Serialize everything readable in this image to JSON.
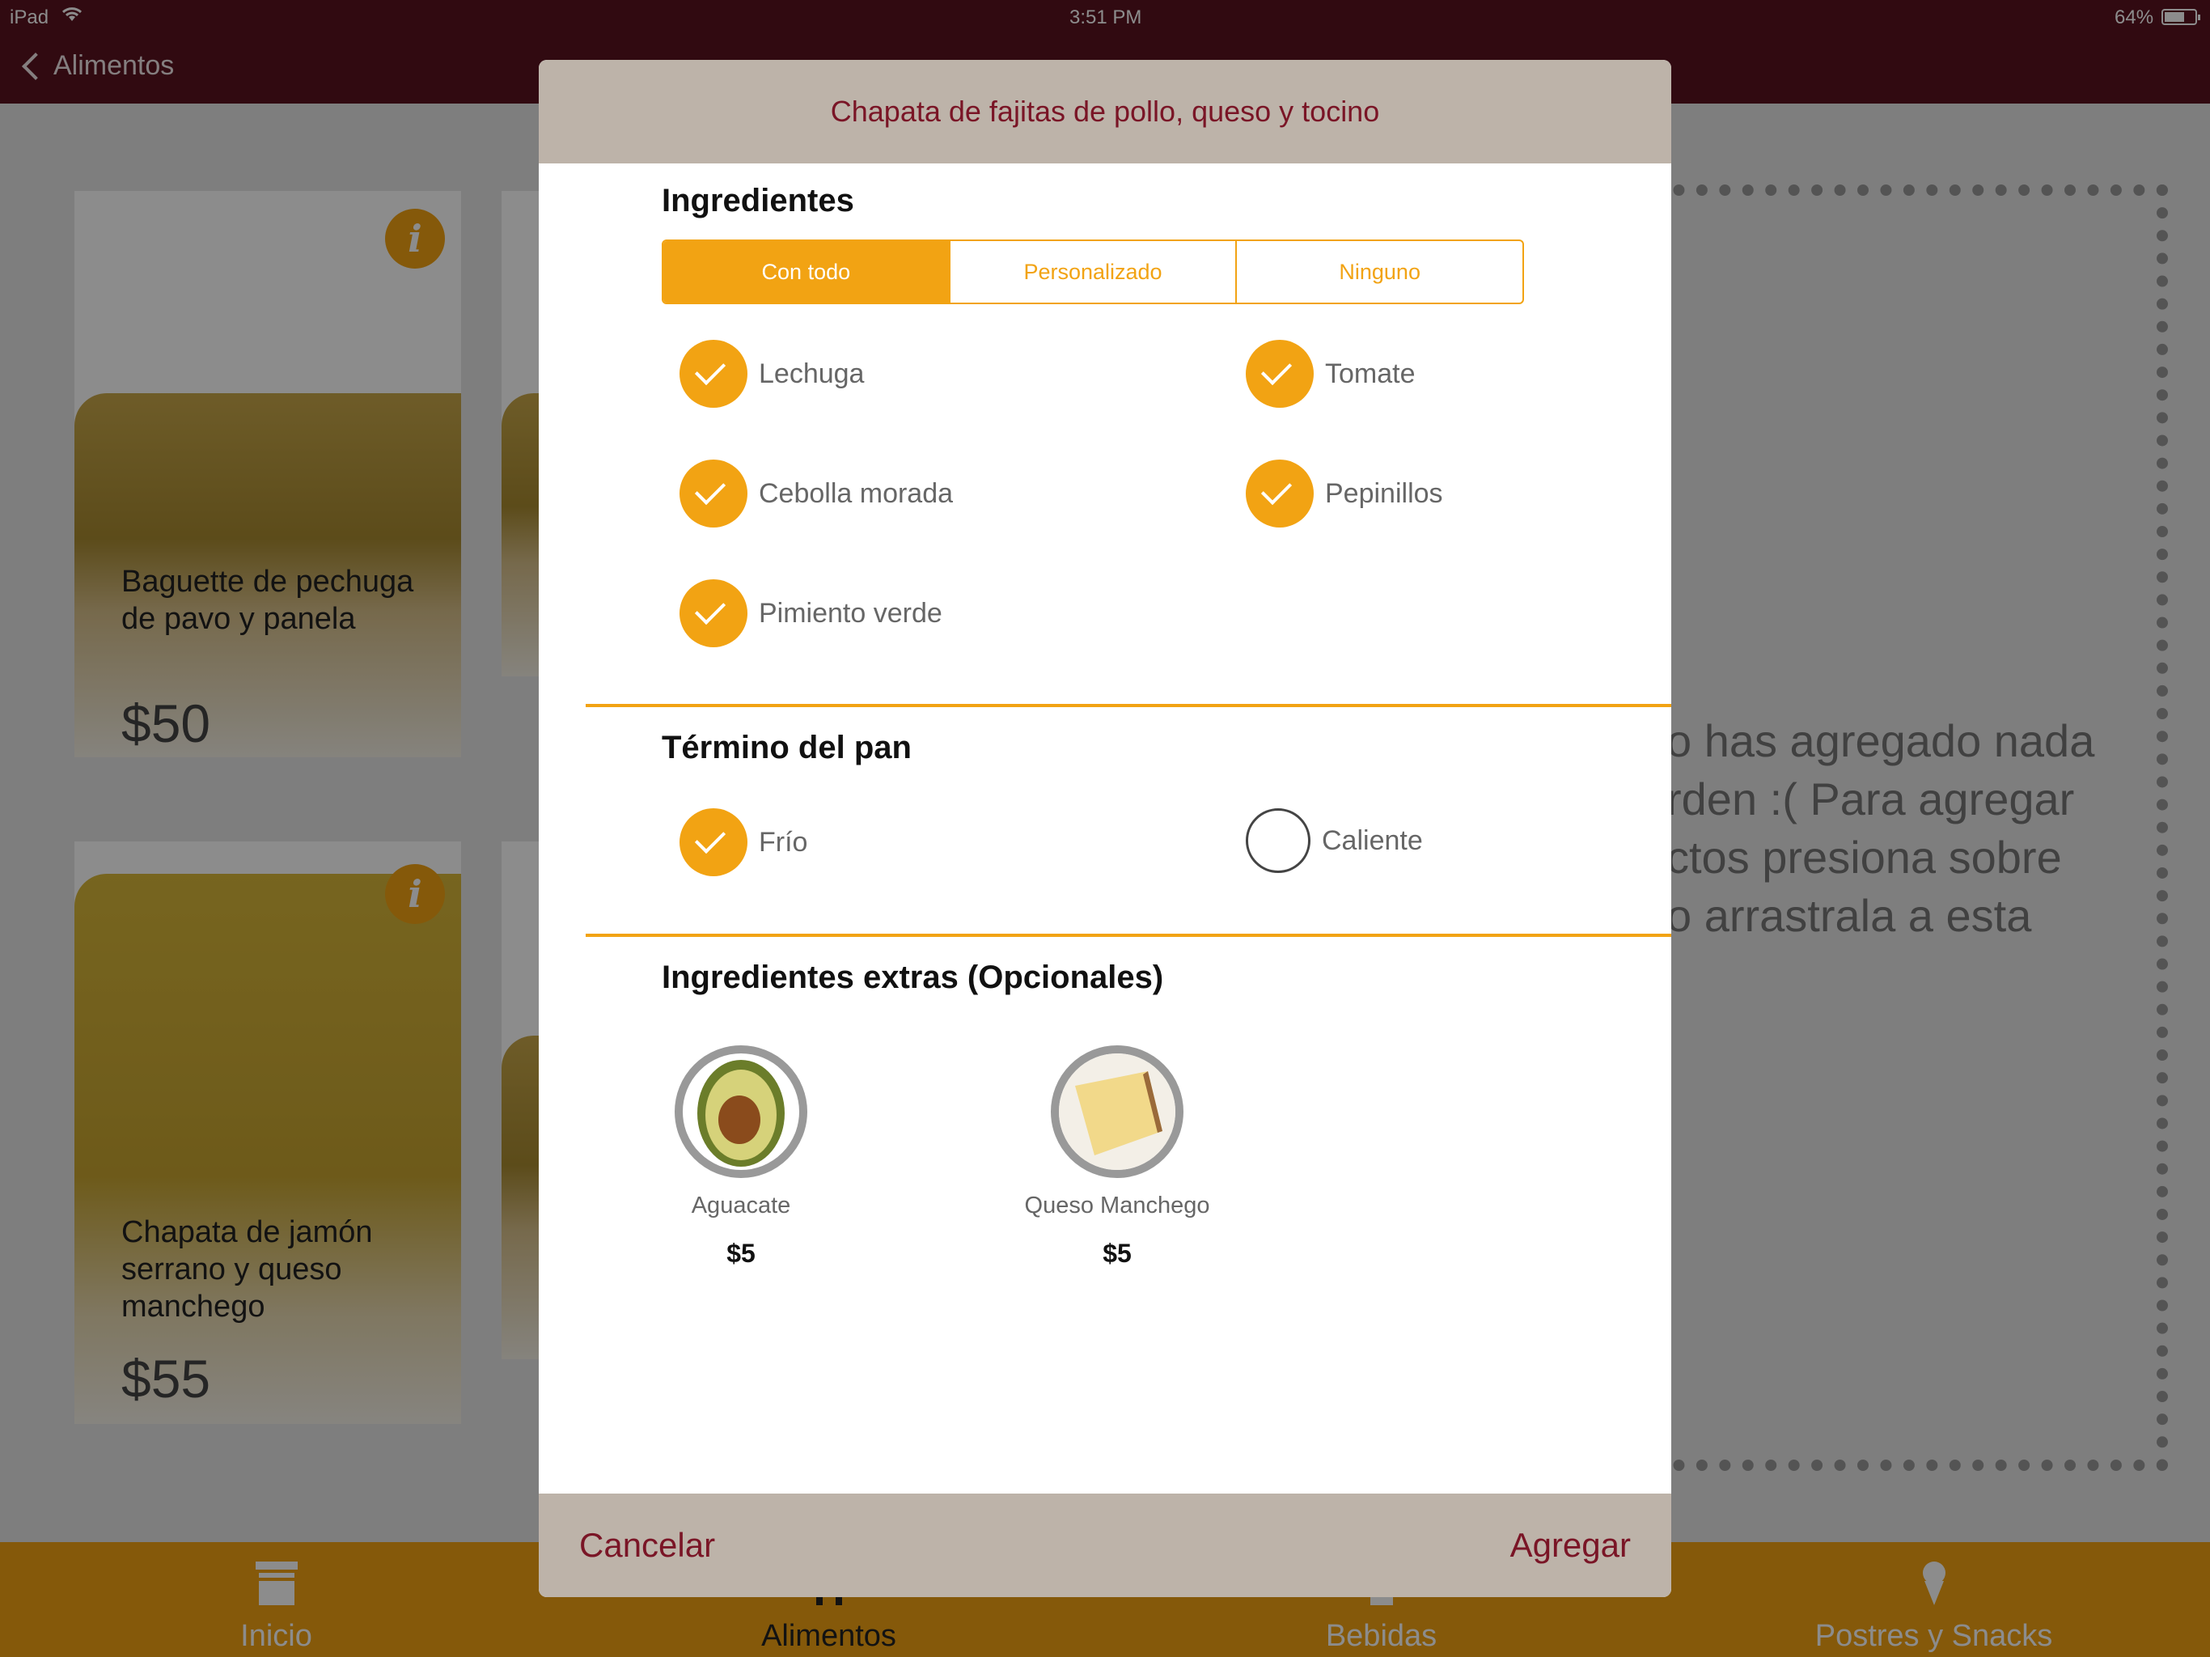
{
  "status": {
    "device": "iPad",
    "time": "3:51 PM",
    "battery": "64%"
  },
  "nav": {
    "back_label": "Alimentos"
  },
  "menu_cards": [
    {
      "title": "Baguette de pechuga de pavo y panela",
      "price": "$50"
    },
    {
      "title": "Chapata de jamón serrano y queso manchego",
      "price": "$55"
    }
  ],
  "order_panel": {
    "empty_lines": [
      "o has agregado nada",
      "rden :(  Para agregar",
      "ctos presiona sobre",
      "o arrastrala a esta"
    ]
  },
  "tabbar": {
    "items": [
      {
        "label": "Inicio",
        "icon": "store-icon"
      },
      {
        "label": "Alimentos",
        "icon": "utensils-icon"
      },
      {
        "label": "Bebidas",
        "icon": "cup-icon"
      },
      {
        "label": "Postres y Snacks",
        "icon": "ice-cream-icon"
      }
    ]
  },
  "modal": {
    "title": "Chapata de fajitas de pollo, queso y tocino",
    "ingredients": {
      "heading": "Ingredientes",
      "segments": [
        "Con todo",
        "Personalizado",
        "Ninguno"
      ],
      "selected_segment": "Con todo",
      "items": [
        {
          "label": "Lechuga",
          "checked": true
        },
        {
          "label": "Tomate",
          "checked": true
        },
        {
          "label": "Cebolla morada",
          "checked": true
        },
        {
          "label": "Pepinillos",
          "checked": true
        },
        {
          "label": "Pimiento verde",
          "checked": true
        }
      ]
    },
    "bread": {
      "heading": "Término del pan",
      "options": [
        {
          "label": "Frío",
          "selected": true
        },
        {
          "label": "Caliente",
          "selected": false
        }
      ]
    },
    "extras": {
      "heading": "Ingredientes extras (Opcionales)",
      "items": [
        {
          "name": "Aguacate",
          "price": "$5",
          "icon": "avocado-icon"
        },
        {
          "name": "Queso Manchego",
          "price": "$5",
          "icon": "cheese-icon"
        }
      ]
    },
    "cancel_label": "Cancelar",
    "add_label": "Agregar"
  },
  "colors": {
    "primary": "#5a1320",
    "accent": "#f2a313",
    "modal_bar": "#bdb3a9",
    "action_text": "#7a1526"
  }
}
